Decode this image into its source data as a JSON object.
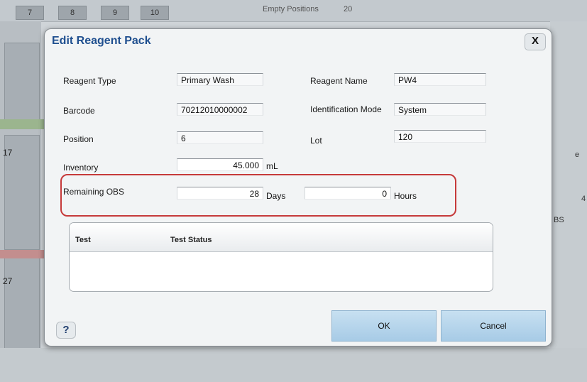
{
  "background": {
    "slots": [
      "7",
      "8",
      "9",
      "10"
    ],
    "top_label": "Empty Positions",
    "top_value": "20",
    "row_numbers": [
      "17",
      "27"
    ],
    "right_texts": [
      "e",
      "4",
      "BS"
    ]
  },
  "dialog": {
    "title": "Edit Reagent Pack",
    "close_label": "X",
    "fields": {
      "reagent_type": {
        "label": "Reagent Type",
        "value": "Primary Wash"
      },
      "reagent_name": {
        "label": "Reagent Name",
        "value": "PW4"
      },
      "barcode": {
        "label": "Barcode",
        "value": "70212010000002"
      },
      "identification_mode": {
        "label": "Identification Mode",
        "value": "System"
      },
      "position": {
        "label": "Position",
        "value": "6"
      },
      "lot": {
        "label": "Lot",
        "value": "120"
      },
      "inventory": {
        "label": "Inventory",
        "value": "45.000",
        "unit": "mL"
      },
      "remaining_obs": {
        "label": "Remaining OBS",
        "days_value": "28",
        "days_unit": "Days",
        "hours_value": "0",
        "hours_unit": "Hours"
      }
    },
    "table": {
      "columns": [
        "Test",
        "Test Status"
      ],
      "rows": []
    },
    "help_label": "?",
    "ok_label": "OK",
    "cancel_label": "Cancel"
  },
  "colors": {
    "title": "#1f4f8f",
    "highlight_border": "#c63a3a",
    "button_fill": "#b5d4eb"
  }
}
